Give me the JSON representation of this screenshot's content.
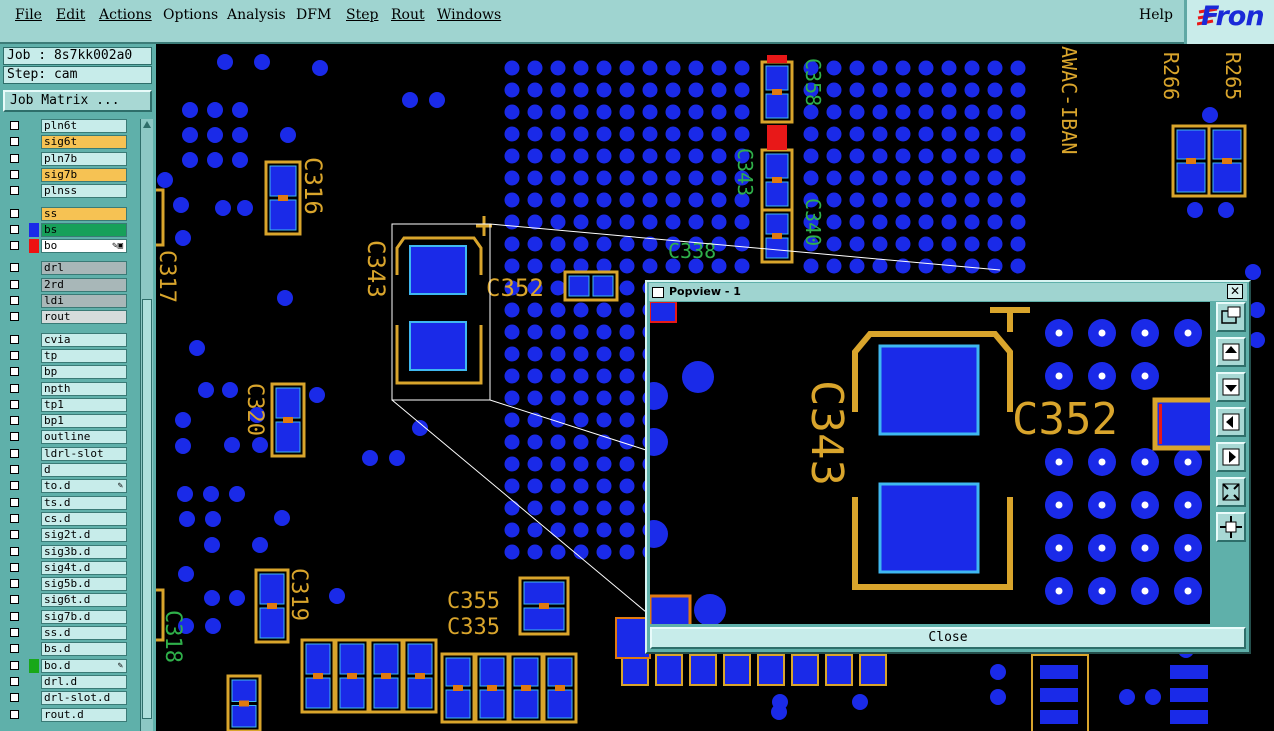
{
  "menubar": {
    "items": [
      "File",
      "Edit",
      "Actions",
      "Options",
      "Analysis",
      "DFM",
      "Step",
      "Rout",
      "Windows"
    ],
    "help": "Help",
    "logo_text": "Fron"
  },
  "job": {
    "job_label": "Job : 8s7kk002a0",
    "step_label": "Step: cam",
    "matrix_button": "Job Matrix ..."
  },
  "layers": [
    {
      "name": "pln6t",
      "style": "plain"
    },
    {
      "name": "sig6t",
      "style": "orange"
    },
    {
      "name": "pln7b",
      "style": "plain"
    },
    {
      "name": "sig7b",
      "style": "orange"
    },
    {
      "name": "plnss",
      "style": "plain"
    },
    {
      "name": "ss",
      "style": "orange"
    },
    {
      "name": "bs",
      "style": "green",
      "color": "#1a2ae8"
    },
    {
      "name": "bo",
      "style": "white",
      "color": "#ee1111",
      "mark": "✎▣"
    },
    {
      "name": "drl",
      "style": "gray"
    },
    {
      "name": "2rd",
      "style": "gray"
    },
    {
      "name": "ldi",
      "style": "gray"
    },
    {
      "name": "rout",
      "style": "lgray"
    },
    {
      "name": "cvia",
      "style": "plain"
    },
    {
      "name": "tp",
      "style": "plain"
    },
    {
      "name": "bp",
      "style": "plain"
    },
    {
      "name": "npth",
      "style": "plain"
    },
    {
      "name": "tp1",
      "style": "plain"
    },
    {
      "name": "bp1",
      "style": "plain"
    },
    {
      "name": "outline",
      "style": "plain"
    },
    {
      "name": "ldrl-slot",
      "style": "plain"
    },
    {
      "name": "d",
      "style": "plain"
    },
    {
      "name": "to.d",
      "style": "plain",
      "mark": "✎"
    },
    {
      "name": "ts.d",
      "style": "plain"
    },
    {
      "name": "cs.d",
      "style": "plain"
    },
    {
      "name": "sig2t.d",
      "style": "plain"
    },
    {
      "name": "sig3b.d",
      "style": "plain"
    },
    {
      "name": "sig4t.d",
      "style": "plain"
    },
    {
      "name": "sig5b.d",
      "style": "plain"
    },
    {
      "name": "sig6t.d",
      "style": "plain"
    },
    {
      "name": "sig7b.d",
      "style": "plain"
    },
    {
      "name": "ss.d",
      "style": "plain"
    },
    {
      "name": "bs.d",
      "style": "plain"
    },
    {
      "name": "bo.d",
      "style": "plain",
      "color": "#18a818",
      "mark": "✎"
    },
    {
      "name": "drl.d",
      "style": "plain"
    },
    {
      "name": "drl-slot.d",
      "style": "plain"
    },
    {
      "name": "rout.d",
      "style": "plain"
    }
  ],
  "canvas": {
    "labels": [
      "C316",
      "C343",
      "C352",
      "C320",
      "C319",
      "C317",
      "C318",
      "C358",
      "C343",
      "C340",
      "C338",
      "C355",
      "C335",
      "R266",
      "R265",
      "AWAC-IBAN"
    ],
    "colors": {
      "pad": "#1a2ae8",
      "pad_outline": "#3fb8f0",
      "silk": "#d9a52c",
      "copper": "#e07a10",
      "green_silk": "#2fb04a",
      "red": "#e81818"
    }
  },
  "popview": {
    "title": "Popview - 1",
    "close_x": "✕",
    "close_button": "Close",
    "labels": {
      "c343": "C343",
      "c352": "C352"
    }
  }
}
